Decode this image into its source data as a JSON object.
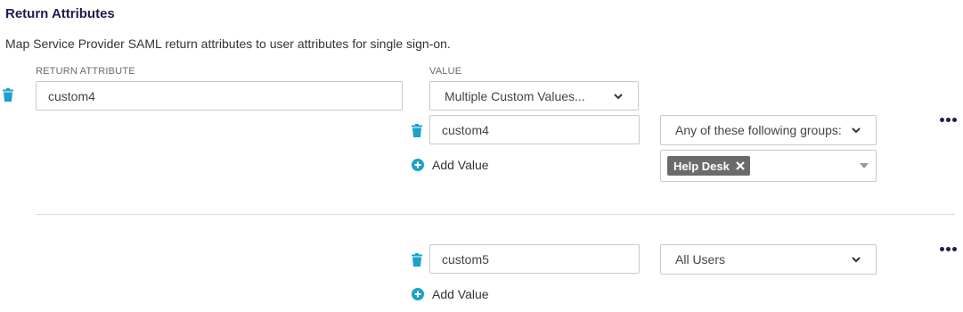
{
  "section": {
    "title": "Return Attributes",
    "description": "Map Service Provider SAML return attributes to user attributes for single sign-on."
  },
  "columns": {
    "return_attribute": "RETURN ATTRIBUTE",
    "value": "VALUE"
  },
  "mapping1": {
    "return_attribute_value": "custom4",
    "value_type": "Multiple Custom Values...",
    "custom_value": "custom4",
    "condition": "Any of these following groups:",
    "group_tag": "Help Desk",
    "add_value_label": "Add Value"
  },
  "mapping2": {
    "custom_value": "custom5",
    "condition": "All Users",
    "add_value_label": "Add Value"
  },
  "colors": {
    "accent": "#1aa1cc",
    "heading": "#1d1d4f",
    "tag": "#6b6b6b"
  },
  "icons": {
    "delete": "trash-icon",
    "add": "plus-circle-icon",
    "more": "more-dots-icon",
    "dropdown": "chevron-down-icon",
    "remove_tag": "close-icon"
  }
}
